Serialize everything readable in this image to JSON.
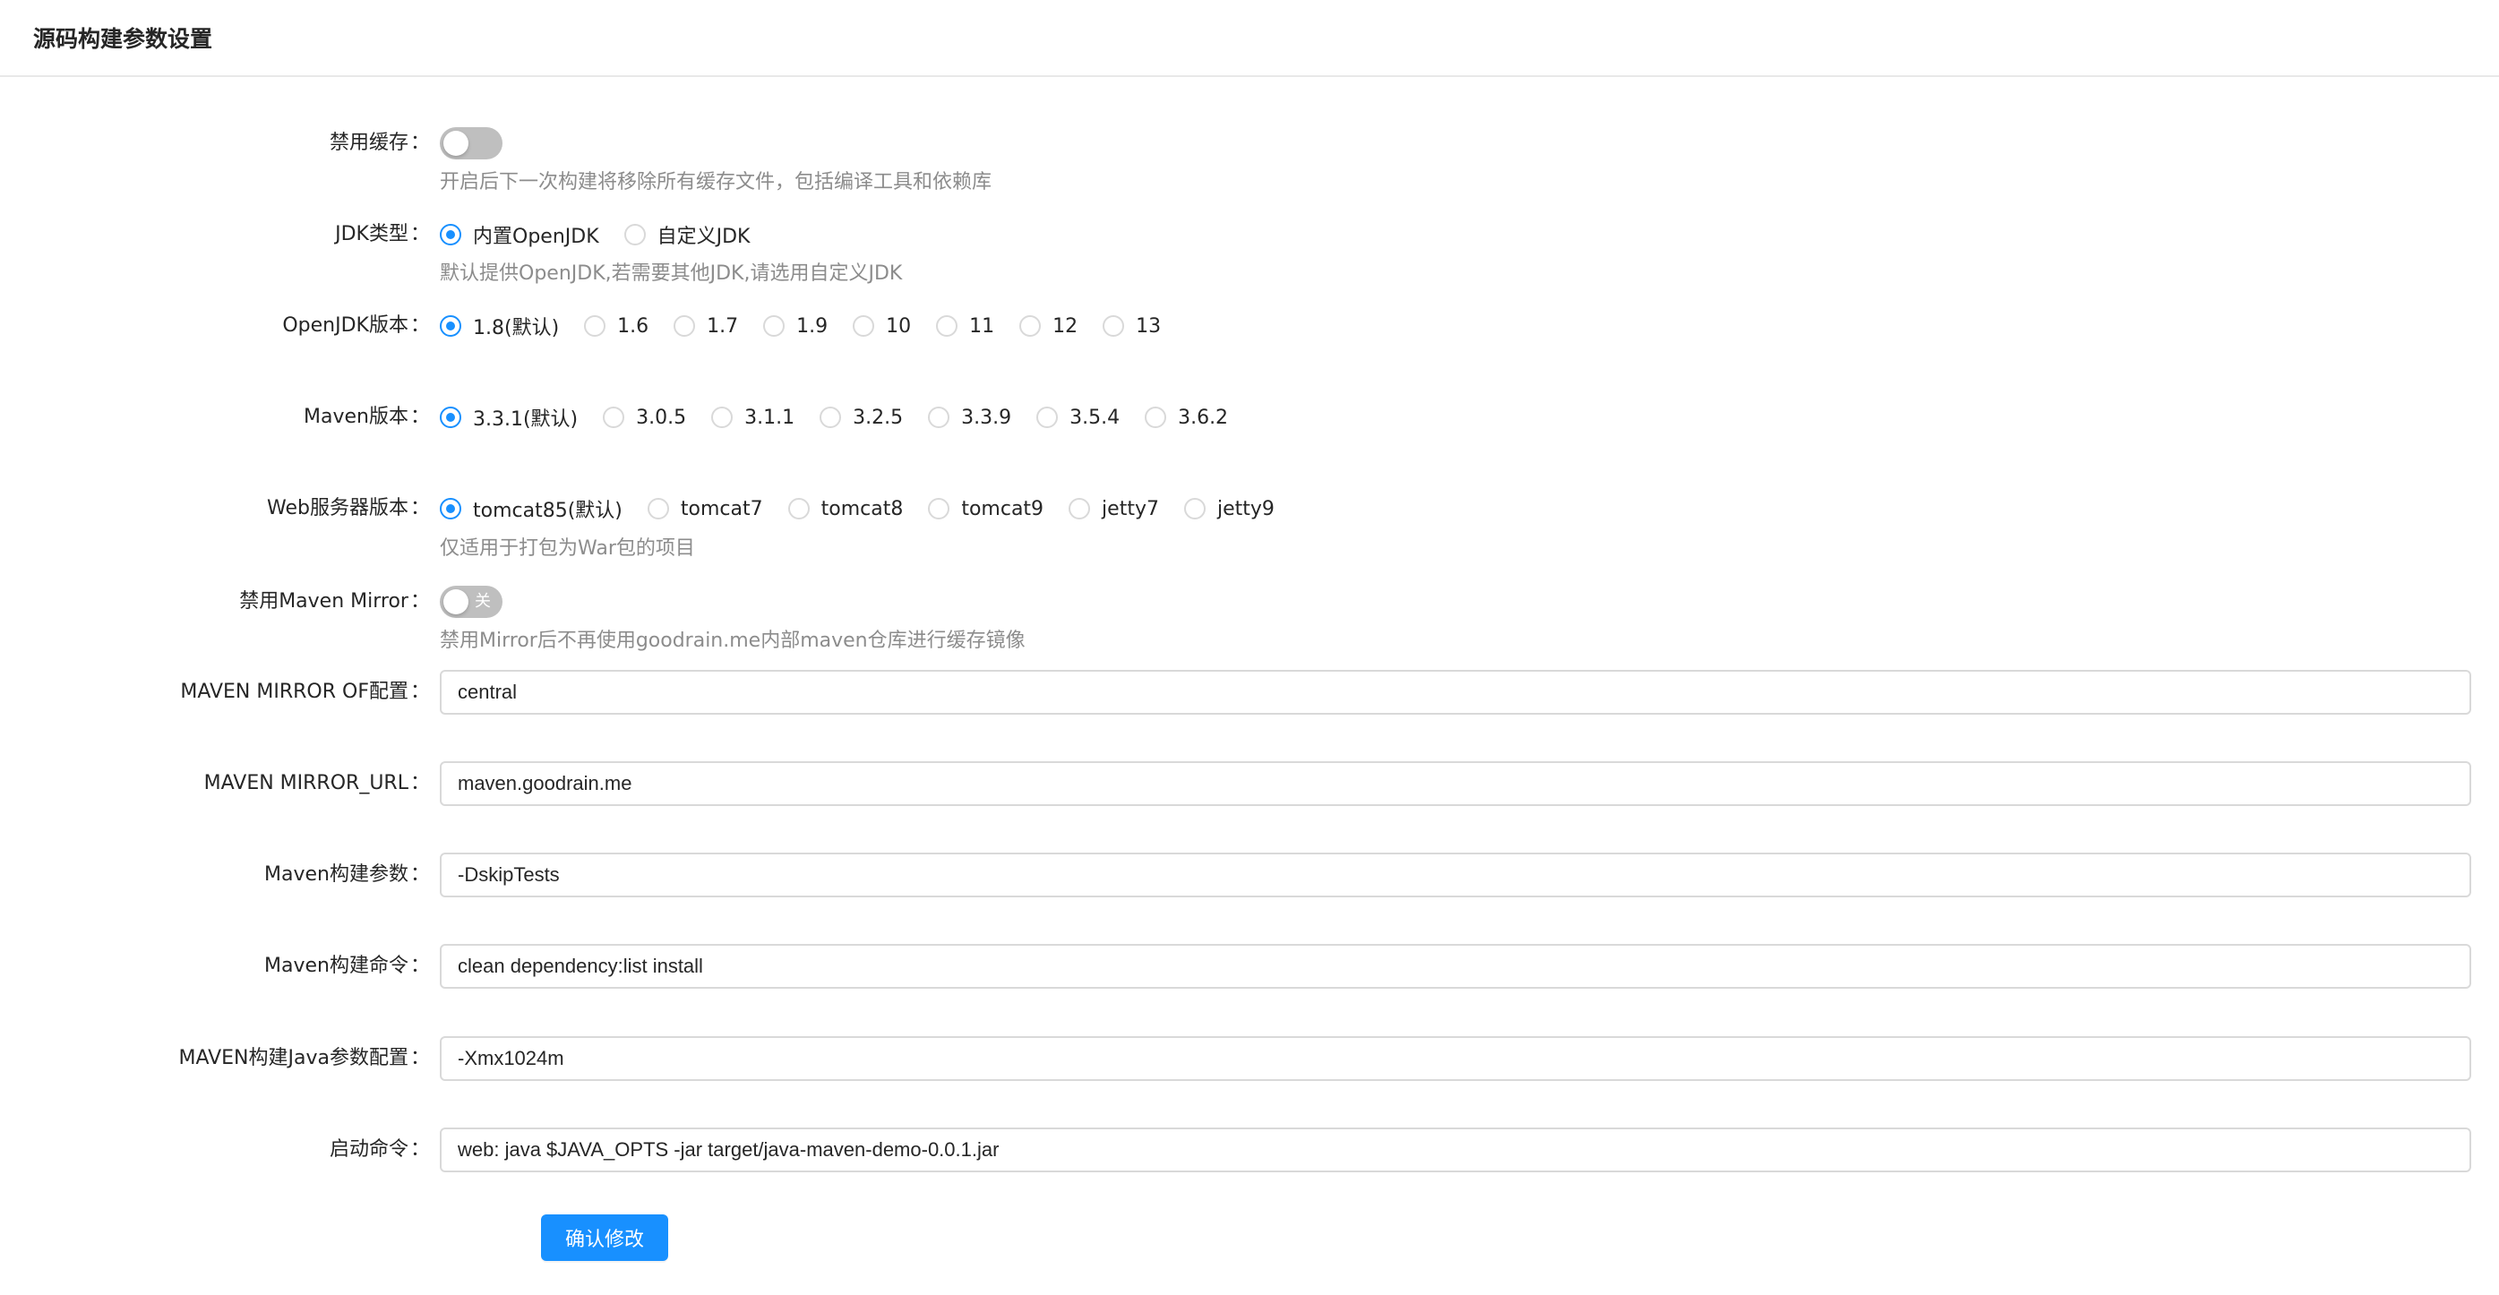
{
  "card": {
    "title": "源码构建参数设置"
  },
  "disable_cache": {
    "label": "禁用缓存",
    "enabled": false,
    "hint": "开启后下一次构建将移除所有缓存文件，包括编译工具和依赖库"
  },
  "jdk_type": {
    "label": "JDK类型",
    "options": [
      "内置OpenJDK",
      "自定义JDK"
    ],
    "selected": 0,
    "hint": "默认提供OpenJDK,若需要其他JDK,请选用自定义JDK"
  },
  "openjdk_version": {
    "label": "OpenJDK版本",
    "options": [
      "1.8(默认)",
      "1.6",
      "1.7",
      "1.9",
      "10",
      "11",
      "12",
      "13"
    ],
    "selected": 0
  },
  "maven_version": {
    "label": "Maven版本",
    "options": [
      "3.3.1(默认)",
      "3.0.5",
      "3.1.1",
      "3.2.5",
      "3.3.9",
      "3.5.4",
      "3.6.2"
    ],
    "selected": 0
  },
  "web_server_version": {
    "label": "Web服务器版本",
    "options": [
      "tomcat85(默认)",
      "tomcat7",
      "tomcat8",
      "tomcat9",
      "jetty7",
      "jetty9"
    ],
    "selected": 0,
    "hint": "仅适用于打包为War包的项目"
  },
  "disable_maven_mirror": {
    "label": "禁用Maven Mirror",
    "enabled": false,
    "switch_text": "关",
    "hint": "禁用Mirror后不再使用goodrain.me内部maven仓库进行缓存镜像"
  },
  "maven_mirror_of": {
    "label": "MAVEN MIRROR OF配置",
    "value": "central"
  },
  "maven_mirror_url": {
    "label": "MAVEN MIRROR_URL",
    "value": "maven.goodrain.me"
  },
  "maven_build_args": {
    "label": "Maven构建参数",
    "value": "-DskipTests"
  },
  "maven_build_cmd": {
    "label": "Maven构建命令",
    "value": "clean dependency:list install"
  },
  "maven_java_opts": {
    "label": "MAVEN构建Java参数配置",
    "value": "-Xmx1024m"
  },
  "start_cmd": {
    "label": "启动命令",
    "value": "web: java $JAVA_OPTS -jar target/java-maven-demo-0.0.1.jar"
  },
  "submit": {
    "label": "确认修改"
  },
  "colon": "："
}
